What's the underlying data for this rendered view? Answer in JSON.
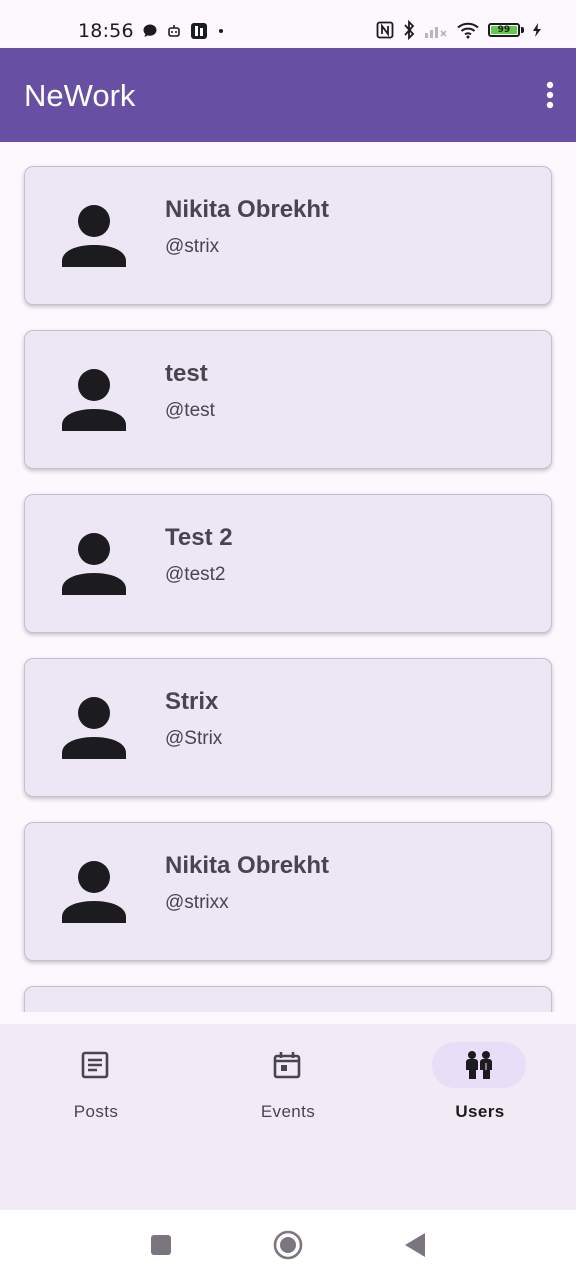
{
  "status_bar": {
    "time": "18:56",
    "left_icons": [
      "chat-bubble-icon",
      "robot-icon",
      "office-app-icon",
      "notification-dot-icon"
    ],
    "right_icons": [
      "nfc-icon",
      "bluetooth-icon",
      "cellular-no-signal-icon",
      "wifi-icon",
      "battery-icon",
      "charging-bolt-icon"
    ],
    "battery_percent": "99"
  },
  "app_bar": {
    "title": "NeWork",
    "menu_icon": "more-vertical-icon",
    "background_color": "#6750a4"
  },
  "users": [
    {
      "name": "Nikita Obrekht",
      "login": "@strix"
    },
    {
      "name": "test",
      "login": "@test"
    },
    {
      "name": "Test 2",
      "login": "@test2"
    },
    {
      "name": "Strix",
      "login": "@Strix"
    },
    {
      "name": "Nikita Obrekht",
      "login": "@strixx"
    }
  ],
  "bottom_nav": {
    "items": [
      {
        "label": "Posts",
        "icon": "article-icon",
        "selected": false
      },
      {
        "label": "Events",
        "icon": "calendar-icon",
        "selected": false
      },
      {
        "label": "Users",
        "icon": "people-icon",
        "selected": true
      }
    ],
    "indicator_color": "#e8def8"
  },
  "system_nav": {
    "buttons": [
      "recents-square-icon",
      "home-circle-icon",
      "back-triangle-icon"
    ]
  }
}
